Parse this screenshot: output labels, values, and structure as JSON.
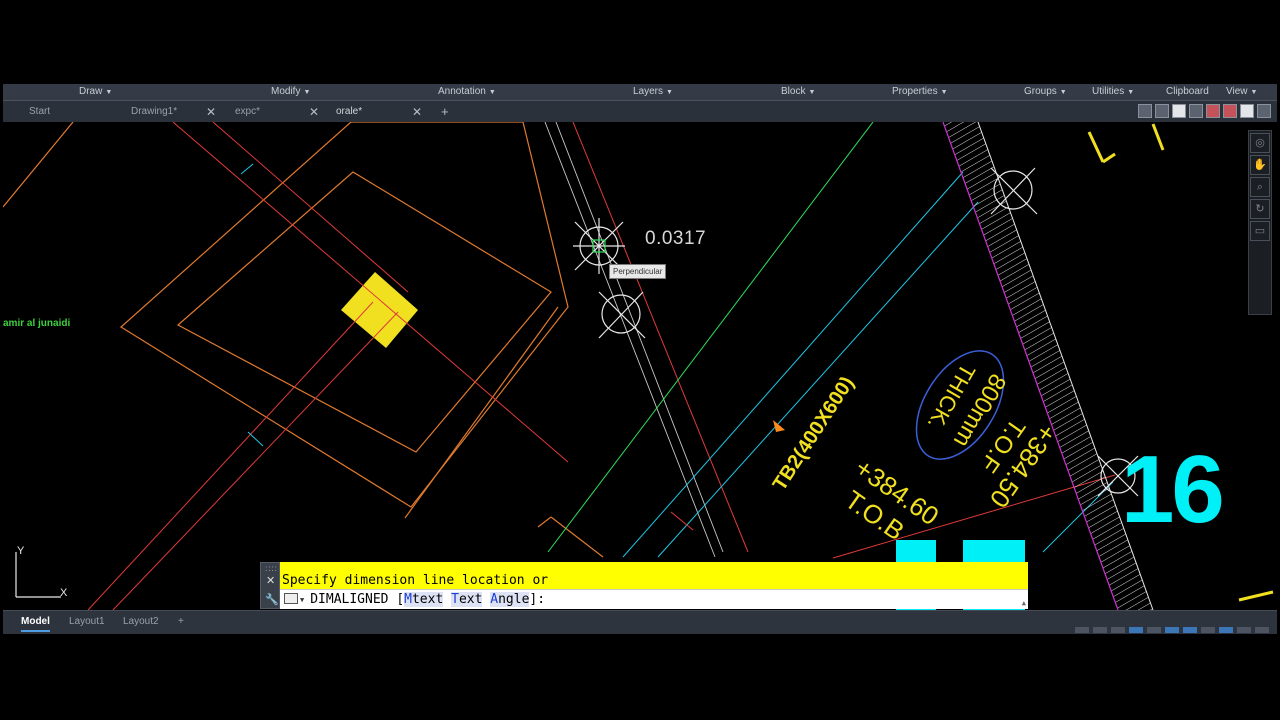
{
  "ribbon": {
    "panels": [
      {
        "label": "Draw"
      },
      {
        "label": "Modify"
      },
      {
        "label": "Annotation"
      },
      {
        "label": "Layers"
      },
      {
        "label": "Block"
      },
      {
        "label": "Properties"
      },
      {
        "label": "Groups"
      },
      {
        "label": "Utilities"
      },
      {
        "label": "Clipboard"
      },
      {
        "label": "View"
      }
    ],
    "caret_icon": "chevron-down-icon"
  },
  "doc_tabs": {
    "tabs": [
      {
        "label": "Start"
      },
      {
        "label": "Drawing1*"
      },
      {
        "label": "expc*"
      },
      {
        "label": "orale*"
      }
    ],
    "close_glyph": "✕",
    "add_glyph": "+"
  },
  "canvas": {
    "watermark": "amir al junaidi",
    "dimension_readout": "0.0317",
    "snap_tooltip": "Perpendicular",
    "labels": {
      "beam": "TB2(400X600)",
      "elev1": "+384.60",
      "elev1_prefix": "T.O.B",
      "elev2": "+384.50",
      "elev2_prefix": "T.O.F",
      "thick_value": "800mm",
      "thick_label": "THICK.",
      "big_number": "16"
    },
    "colors": {
      "background": "#000000",
      "footing": "#e07a2e",
      "beam_line": "#e03a3a",
      "green_line": "#2ee05a",
      "cyan_line": "#1ec8e8",
      "yellow_text": "#f0e020",
      "big_number": "#00f0f8",
      "hatch_boundary": "#d030d0"
    }
  },
  "nav_bar": {
    "icons": [
      "steering-wheel-icon",
      "pan-icon",
      "zoom-icon",
      "orbit-icon",
      "showmotion-icon"
    ]
  },
  "command_line": {
    "history": "Specify dimension line location or",
    "command": "DIMALIGNED",
    "bracket_open": "[",
    "bracket_close": "]:",
    "options": [
      {
        "key": "M",
        "rest": "text"
      },
      {
        "key": "T",
        "rest": "ext"
      },
      {
        "key": "A",
        "rest": "ngle"
      }
    ],
    "close_glyph": "✕",
    "customize_icon": "wrench-icon"
  },
  "status_bar": {
    "layout_tabs": [
      {
        "label": "Model"
      },
      {
        "label": "Layout1"
      },
      {
        "label": "Layout2"
      }
    ],
    "add_glyph": "+"
  },
  "ucs": {
    "x_label": "X",
    "y_label": "Y"
  }
}
